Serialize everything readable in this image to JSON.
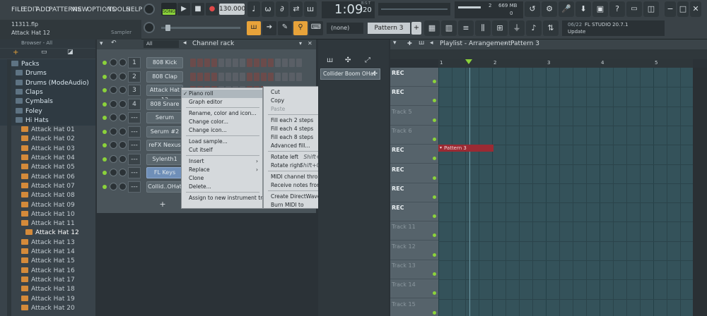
{
  "menu": [
    "FILE",
    "EDIT",
    "ADD",
    "PATTERNS",
    "VIEW",
    "OPTIONS",
    "TOOLS",
    "HELP"
  ],
  "transport": {
    "mode_label": "SONG",
    "tempo": "130.000",
    "time": "1:09",
    "time_sub": "20",
    "time_unit": "B:S:T"
  },
  "hint_bar": {
    "file": "11311.flp",
    "selection": "Attack Hat 12",
    "plugin": "Sampler"
  },
  "pattern": {
    "none": "(none)",
    "current": "Pattern 3"
  },
  "perf": {
    "mem": "669 MB",
    "cpu": "2",
    "poly": "0"
  },
  "news": {
    "date": "06/22",
    "title": "FL STUDIO 20.7.1",
    "sub": "Update"
  },
  "browser": {
    "title": "Browser - All",
    "items": [
      {
        "label": "Packs",
        "type": "folder"
      },
      {
        "label": "Drums",
        "type": "folder"
      },
      {
        "label": "Drums (ModeAudio)",
        "type": "folder"
      },
      {
        "label": "Claps",
        "type": "folder"
      },
      {
        "label": "Cymbals",
        "type": "folder"
      },
      {
        "label": "Foley",
        "type": "folder"
      },
      {
        "label": "Hi Hats",
        "type": "folder"
      },
      {
        "label": "Attack Hat 01",
        "type": "file"
      },
      {
        "label": "Attack Hat 02",
        "type": "file"
      },
      {
        "label": "Attack Hat 03",
        "type": "file"
      },
      {
        "label": "Attack Hat 04",
        "type": "file"
      },
      {
        "label": "Attack Hat 05",
        "type": "file"
      },
      {
        "label": "Attack Hat 06",
        "type": "file"
      },
      {
        "label": "Attack Hat 07",
        "type": "file"
      },
      {
        "label": "Attack Hat 08",
        "type": "file"
      },
      {
        "label": "Attack Hat 09",
        "type": "file"
      },
      {
        "label": "Attack Hat 10",
        "type": "file"
      },
      {
        "label": "Attack Hat 11",
        "type": "file"
      },
      {
        "label": "Attack Hat 12",
        "type": "file"
      },
      {
        "label": "Attack Hat 13",
        "type": "file"
      },
      {
        "label": "Attack Hat 14",
        "type": "file"
      },
      {
        "label": "Attack Hat 15",
        "type": "file"
      },
      {
        "label": "Attack Hat 16",
        "type": "file"
      },
      {
        "label": "Attack Hat 17",
        "type": "file"
      },
      {
        "label": "Attack Hat 18",
        "type": "file"
      },
      {
        "label": "Attack Hat 19",
        "type": "file"
      },
      {
        "label": "Attack Hat 20",
        "type": "file"
      }
    ]
  },
  "channel_rack": {
    "title": "Channel rack",
    "filter": "All",
    "channels": [
      {
        "num": "1",
        "name": "808 Kick"
      },
      {
        "num": "2",
        "name": "808 Clap"
      },
      {
        "num": "3",
        "name": "Attack Hat 12"
      },
      {
        "num": "4",
        "name": "808 Snare"
      },
      {
        "num": "---",
        "name": "Serum"
      },
      {
        "num": "---",
        "name": "Serum #2"
      },
      {
        "num": "---",
        "name": "reFX Nexus"
      },
      {
        "num": "---",
        "name": "Sylenth1"
      },
      {
        "num": "---",
        "name": "FL Keys"
      },
      {
        "num": "---",
        "name": "Collid..OHat"
      }
    ],
    "add_label": "+"
  },
  "context_menu_left": [
    {
      "label": "Piano roll",
      "selected": true
    },
    {
      "label": "Graph editor"
    },
    {
      "label": "Rename, color and icon..."
    },
    {
      "label": "Change color..."
    },
    {
      "label": "Change icon..."
    },
    {
      "label": "Load sample..."
    },
    {
      "label": "Cut itself"
    },
    {
      "label": "Insert",
      "submenu": true
    },
    {
      "label": "Replace",
      "submenu": true
    },
    {
      "label": "Clone"
    },
    {
      "label": "Delete..."
    },
    {
      "label": "Assign to new instrument track"
    }
  ],
  "context_menu_right": [
    {
      "label": "Cut"
    },
    {
      "label": "Copy"
    },
    {
      "label": "Paste",
      "disabled": true
    },
    {
      "label": "Fill each 2 steps"
    },
    {
      "label": "Fill each 4 steps"
    },
    {
      "label": "Fill each 8 steps"
    },
    {
      "label": "Advanced fill..."
    },
    {
      "label": "Rotate left",
      "shortcut": "Shift+Ctrl+Left"
    },
    {
      "label": "Rotate right",
      "shortcut": "Shift+Ctrl+Right"
    },
    {
      "label": "MIDI channel through"
    },
    {
      "label": "Receive notes from",
      "submenu": true
    },
    {
      "label": "Create DirectWave instrument..."
    },
    {
      "label": "Burn MIDI to",
      "submenu": true
    }
  ],
  "instrument_strip": {
    "item": "Collider Boom OHat"
  },
  "playlist": {
    "title": "Playlist - Arrangement",
    "pattern": "Pattern 3",
    "ruler": [
      "1",
      "2",
      "3",
      "4",
      "5"
    ],
    "tracks": [
      {
        "label": "REC",
        "rec": true
      },
      {
        "label": "REC",
        "rec": true
      },
      {
        "label": "Track 5",
        "rec": false
      },
      {
        "label": "Track 6",
        "rec": false
      },
      {
        "label": "REC",
        "rec": true
      },
      {
        "label": "REC",
        "rec": true
      },
      {
        "label": "REC",
        "rec": true
      },
      {
        "label": "REC",
        "rec": true
      },
      {
        "label": "Track 11",
        "rec": false
      },
      {
        "label": "Track 12",
        "rec": false
      },
      {
        "label": "Track 13",
        "rec": false
      },
      {
        "label": "Track 14",
        "rec": false
      },
      {
        "label": "Track 15",
        "rec": false
      }
    ],
    "clip": {
      "label": "Pattern 3"
    }
  }
}
